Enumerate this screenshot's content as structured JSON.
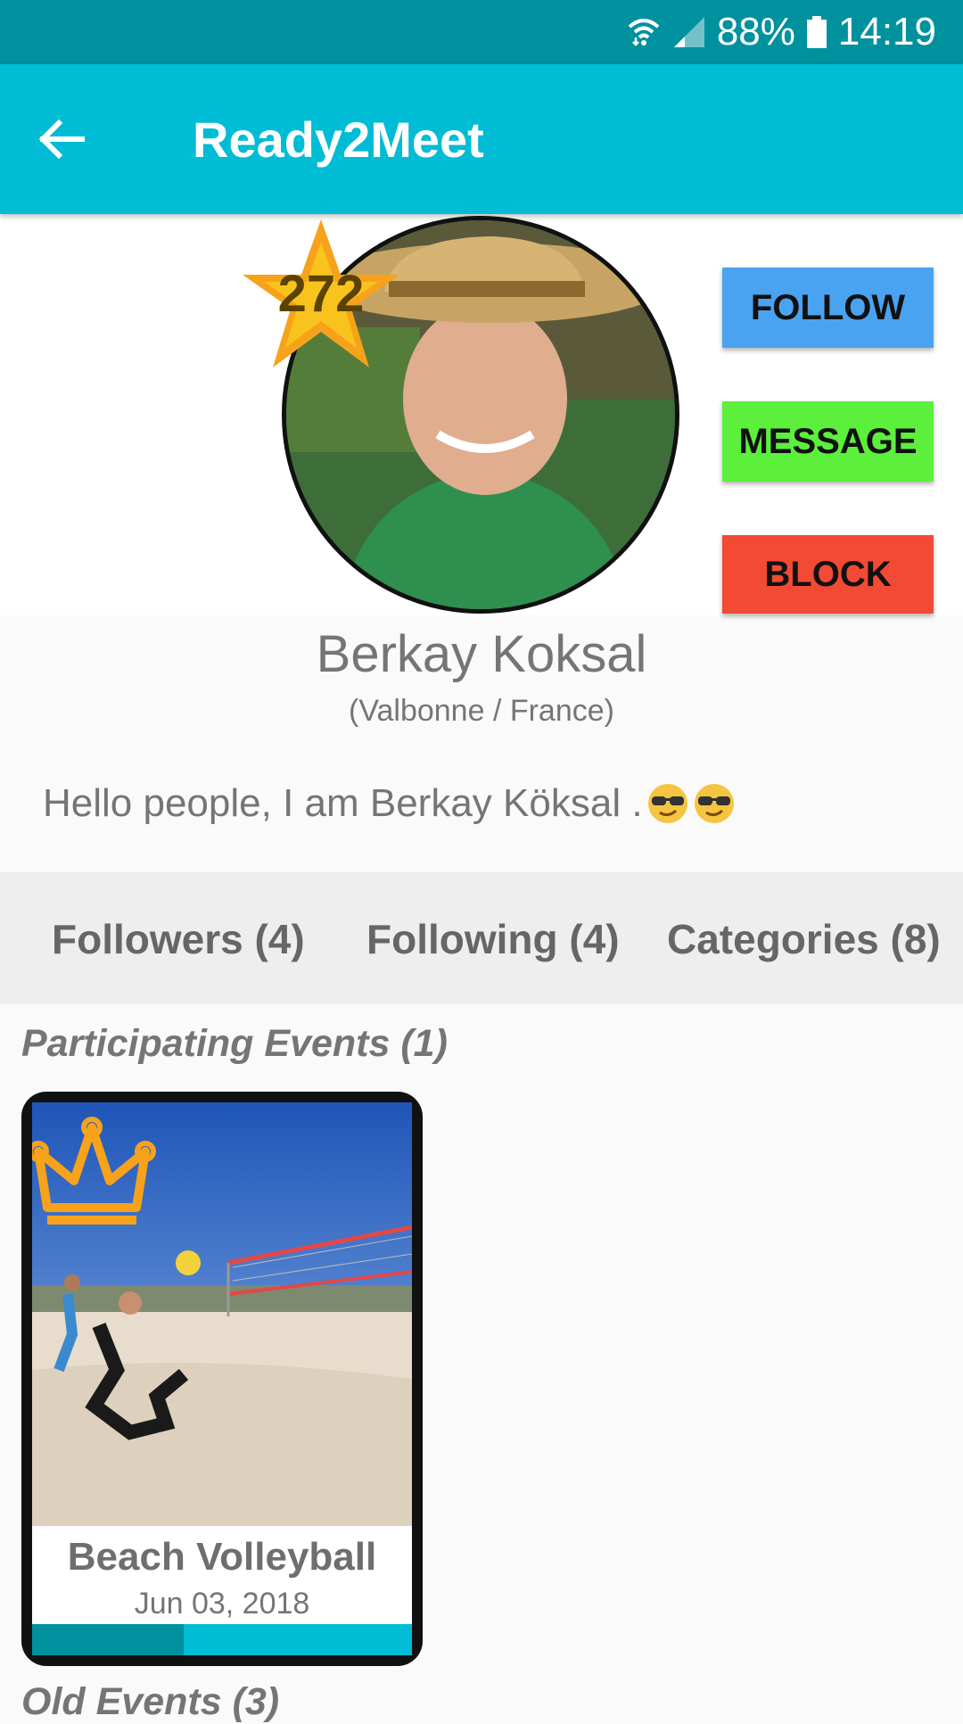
{
  "status_bar": {
    "battery": "88%",
    "time": "14:19"
  },
  "app_bar": {
    "title": "Ready2Meet"
  },
  "profile": {
    "points": "272",
    "name": "Berkay Koksal",
    "location": "(Valbonne / France)",
    "bio": "Hello people, I am Berkay Köksal . "
  },
  "actions": {
    "follow": "FOLLOW",
    "message": "MESSAGE",
    "block": "BLOCK"
  },
  "tabs": [
    {
      "label": "Followers (4)"
    },
    {
      "label": "Following (4)"
    },
    {
      "label": "Categories (8)"
    }
  ],
  "sections": {
    "participating": "Participating Events (1)",
    "old": "Old Events (3)"
  },
  "events": [
    {
      "title": "Beach Volleyball",
      "date": "Jun 03, 2018",
      "progress": 0.4
    }
  ],
  "colors": {
    "primary": "#00bcd4",
    "primary_dark": "#00919f",
    "follow": "#4aa3f0",
    "message": "#5cf03c",
    "block": "#f24a35",
    "star": "#f7a21b",
    "crown": "#f7a21b"
  }
}
